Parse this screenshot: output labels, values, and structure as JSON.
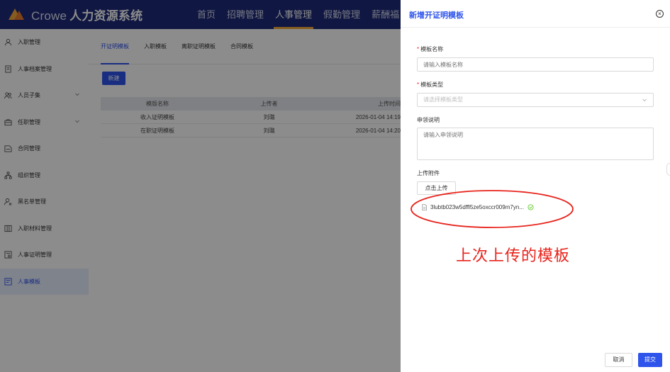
{
  "header": {
    "brand": "Crowe",
    "system_name": "人力资源系统",
    "nav": [
      "首页",
      "招聘管理",
      "人事管理",
      "假勤管理",
      "薪酬福"
    ],
    "active_nav": "人事管理"
  },
  "sidebar": {
    "items": [
      {
        "label": "入职管理",
        "icon": "user-icon"
      },
      {
        "label": "人事档案管理",
        "icon": "document-icon"
      },
      {
        "label": "人员子集",
        "icon": "group-icon",
        "expandable": true
      },
      {
        "label": "任职管理",
        "icon": "briefcase-icon",
        "expandable": true
      },
      {
        "label": "合同管理",
        "icon": "contract-icon"
      },
      {
        "label": "组织管理",
        "icon": "org-icon"
      },
      {
        "label": "黑名单管理",
        "icon": "user-block-icon"
      },
      {
        "label": "入职材料管理",
        "icon": "materials-icon"
      },
      {
        "label": "人事证明管理",
        "icon": "certificate-icon"
      },
      {
        "label": "人事模板",
        "icon": "template-icon",
        "active": true
      }
    ]
  },
  "main": {
    "tabs": [
      "开证明模板",
      "入职模板",
      "离职证明模板",
      "合同模板"
    ],
    "new_button": "新建",
    "table": {
      "headers": [
        "模版名称",
        "上传者",
        "上传时间"
      ],
      "rows": [
        [
          "收入证明模板",
          "刘璐",
          "2026-01-04 14:19"
        ],
        [
          "在职证明模板",
          "刘璐",
          "2026-01-04 14:20"
        ]
      ]
    }
  },
  "drawer": {
    "title": "新增开证明模板",
    "fields": {
      "name_label": "模板名称",
      "name_placeholder": "请输入模板名称",
      "type_label": "模板类型",
      "type_placeholder": "请选择模板类型",
      "desc_label": "申领说明",
      "desc_placeholder": "请输入申领说明",
      "attachment_label": "上传附件"
    },
    "upload_button": "点击上传",
    "file_name": "3lubtb023w5dffl5ze5oxccr009m7yn...",
    "annotation": "上次上传的模板",
    "cancel_button": "取消",
    "submit_button": "提交"
  },
  "colors": {
    "topbar": "#1e2a78",
    "accent": "#2f54eb",
    "annotation": "#e8231b",
    "required": "#f5222d",
    "success": "#52c41a"
  }
}
